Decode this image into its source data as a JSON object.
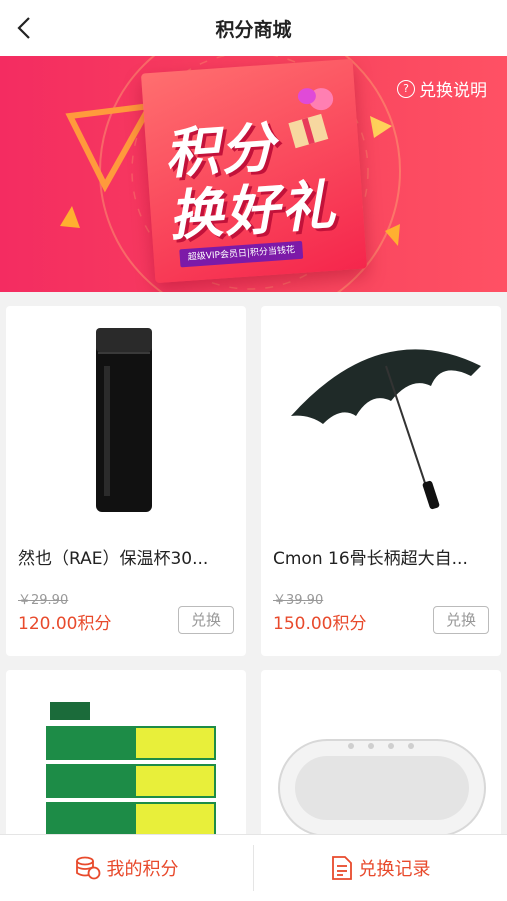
{
  "header": {
    "title": "积分商城",
    "back_icon": "chevron-left-icon"
  },
  "banner": {
    "rules_label": "兑换说明",
    "art_line1": "积分",
    "art_line2": "换好礼",
    "art_subtitle": "超级VIP会员日|积分当钱花"
  },
  "products": [
    {
      "name": "然也（RAE）保温杯30...",
      "original_price": "￥29.90",
      "points": "120.00积分",
      "button": "兑换"
    },
    {
      "name": "Cmon 16骨长柄超大自...",
      "original_price": "￥39.90",
      "points": "150.00积分",
      "button": "兑换"
    },
    {
      "name": "",
      "original_price": "",
      "points": "",
      "button": ""
    },
    {
      "name": "",
      "original_price": "",
      "points": "",
      "button": ""
    }
  ],
  "tabs": [
    {
      "label": "我的积分",
      "icon": "coins-icon"
    },
    {
      "label": "兑换记录",
      "icon": "document-icon"
    }
  ],
  "colors": {
    "accent": "#e84a2c",
    "banner": "#f42c61"
  }
}
